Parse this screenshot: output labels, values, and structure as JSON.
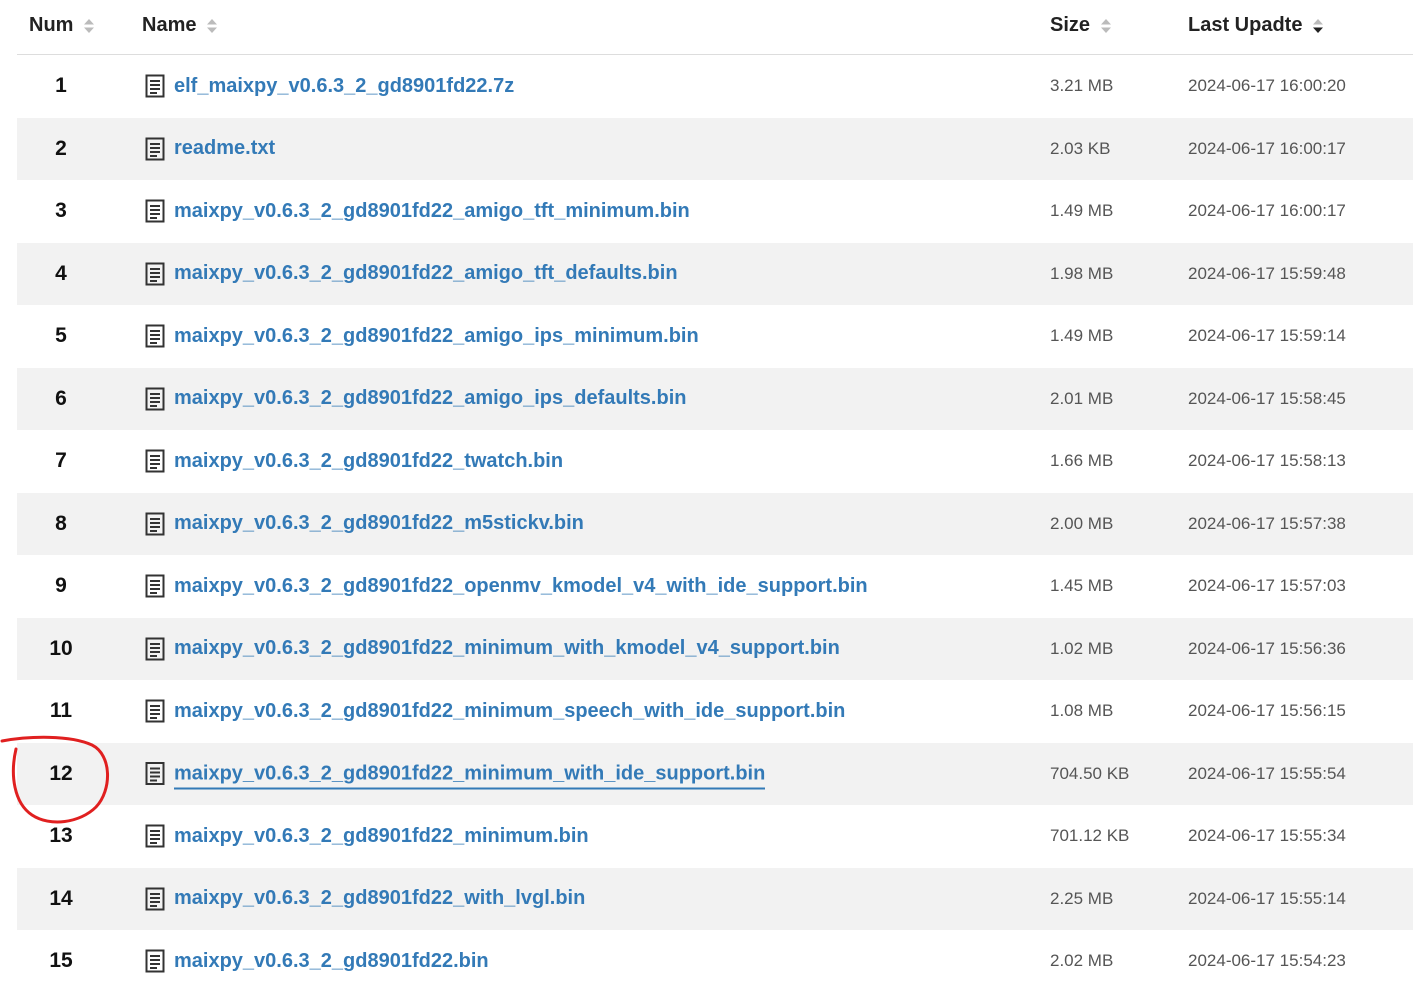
{
  "table": {
    "headers": {
      "num": "Num",
      "name": "Name",
      "size": "Size",
      "date": "Last Upadte"
    },
    "rows": [
      {
        "num": "1",
        "name": "elf_maixpy_v0.6.3_2_gd8901fd22.7z",
        "size": "3.21 MB",
        "date": "2024-06-17 16:00:20"
      },
      {
        "num": "2",
        "name": "readme.txt",
        "size": "2.03 KB",
        "date": "2024-06-17 16:00:17"
      },
      {
        "num": "3",
        "name": "maixpy_v0.6.3_2_gd8901fd22_amigo_tft_minimum.bin",
        "size": "1.49 MB",
        "date": "2024-06-17 16:00:17"
      },
      {
        "num": "4",
        "name": "maixpy_v0.6.3_2_gd8901fd22_amigo_tft_defaults.bin",
        "size": "1.98 MB",
        "date": "2024-06-17 15:59:48"
      },
      {
        "num": "5",
        "name": "maixpy_v0.6.3_2_gd8901fd22_amigo_ips_minimum.bin",
        "size": "1.49 MB",
        "date": "2024-06-17 15:59:14"
      },
      {
        "num": "6",
        "name": "maixpy_v0.6.3_2_gd8901fd22_amigo_ips_defaults.bin",
        "size": "2.01 MB",
        "date": "2024-06-17 15:58:45"
      },
      {
        "num": "7",
        "name": "maixpy_v0.6.3_2_gd8901fd22_twatch.bin",
        "size": "1.66 MB",
        "date": "2024-06-17 15:58:13"
      },
      {
        "num": "8",
        "name": "maixpy_v0.6.3_2_gd8901fd22_m5stickv.bin",
        "size": "2.00 MB",
        "date": "2024-06-17 15:57:38"
      },
      {
        "num": "9",
        "name": "maixpy_v0.6.3_2_gd8901fd22_openmv_kmodel_v4_with_ide_support.bin",
        "size": "1.45 MB",
        "date": "2024-06-17 15:57:03"
      },
      {
        "num": "10",
        "name": "maixpy_v0.6.3_2_gd8901fd22_minimum_with_kmodel_v4_support.bin",
        "size": "1.02 MB",
        "date": "2024-06-17 15:56:36"
      },
      {
        "num": "11",
        "name": "maixpy_v0.6.3_2_gd8901fd22_minimum_speech_with_ide_support.bin",
        "size": "1.08 MB",
        "date": "2024-06-17 15:56:15"
      },
      {
        "num": "12",
        "name": "maixpy_v0.6.3_2_gd8901fd22_minimum_with_ide_support.bin",
        "size": "704.50 KB",
        "date": "2024-06-17 15:55:54"
      },
      {
        "num": "13",
        "name": "maixpy_v0.6.3_2_gd8901fd22_minimum.bin",
        "size": "701.12 KB",
        "date": "2024-06-17 15:55:34"
      },
      {
        "num": "14",
        "name": "maixpy_v0.6.3_2_gd8901fd22_with_lvgl.bin",
        "size": "2.25 MB",
        "date": "2024-06-17 15:55:14"
      },
      {
        "num": "15",
        "name": "maixpy_v0.6.3_2_gd8901fd22.bin",
        "size": "2.02 MB",
        "date": "2024-06-17 15:54:23"
      }
    ]
  },
  "icons": {
    "sort": "sort-icon",
    "sort_active": "sort-desc-icon",
    "file": "file-text-icon"
  },
  "colors": {
    "link": "#337ab7",
    "stripe": "#f2f2f2",
    "annotation": "#e02020"
  }
}
